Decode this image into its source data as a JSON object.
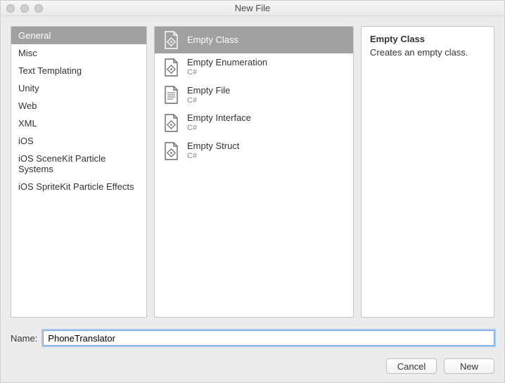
{
  "window": {
    "title": "New File"
  },
  "categories": [
    "General",
    "Misc",
    "Text Templating",
    "Unity",
    "Web",
    "XML",
    "iOS",
    "iOS SceneKit Particle Systems",
    "iOS SpriteKit Particle Effects"
  ],
  "categories_selected_index": 0,
  "templates": [
    {
      "name": "Empty Class",
      "sub": ""
    },
    {
      "name": "Empty Enumeration",
      "sub": "C#"
    },
    {
      "name": "Empty File",
      "sub": "C#"
    },
    {
      "name": "Empty Interface",
      "sub": "C#"
    },
    {
      "name": "Empty Struct",
      "sub": "C#"
    }
  ],
  "templates_selected_index": 0,
  "description": {
    "title": "Empty Class",
    "body": "Creates an empty class."
  },
  "name_field": {
    "label": "Name:",
    "value": "PhoneTranslator"
  },
  "buttons": {
    "cancel": "Cancel",
    "new": "New"
  }
}
